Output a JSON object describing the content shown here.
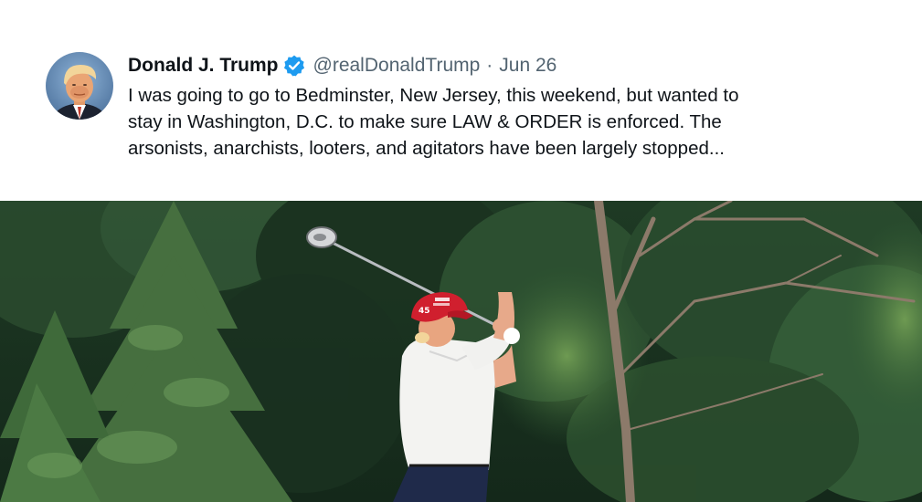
{
  "tweet": {
    "display_name": "Donald J. Trump",
    "verified_icon": "verified-badge-icon",
    "handle": "@realDonaldTrump",
    "separator": "·",
    "date": "Jun 26",
    "text_lines": [
      "I was going to go to Bedminster, New Jersey, this weekend, but wanted to",
      "stay in Washington, D.C. to make sure LAW & ORDER is enforced. The",
      "arsonists, anarchists, looters, and agitators have been largely stopped..."
    ]
  },
  "media": {
    "hat_text": "45"
  },
  "colors": {
    "name": "#0f1419",
    "secondary": "#536471",
    "verified_blue": "#1d9bf0",
    "hat_red": "#d01f2e"
  }
}
